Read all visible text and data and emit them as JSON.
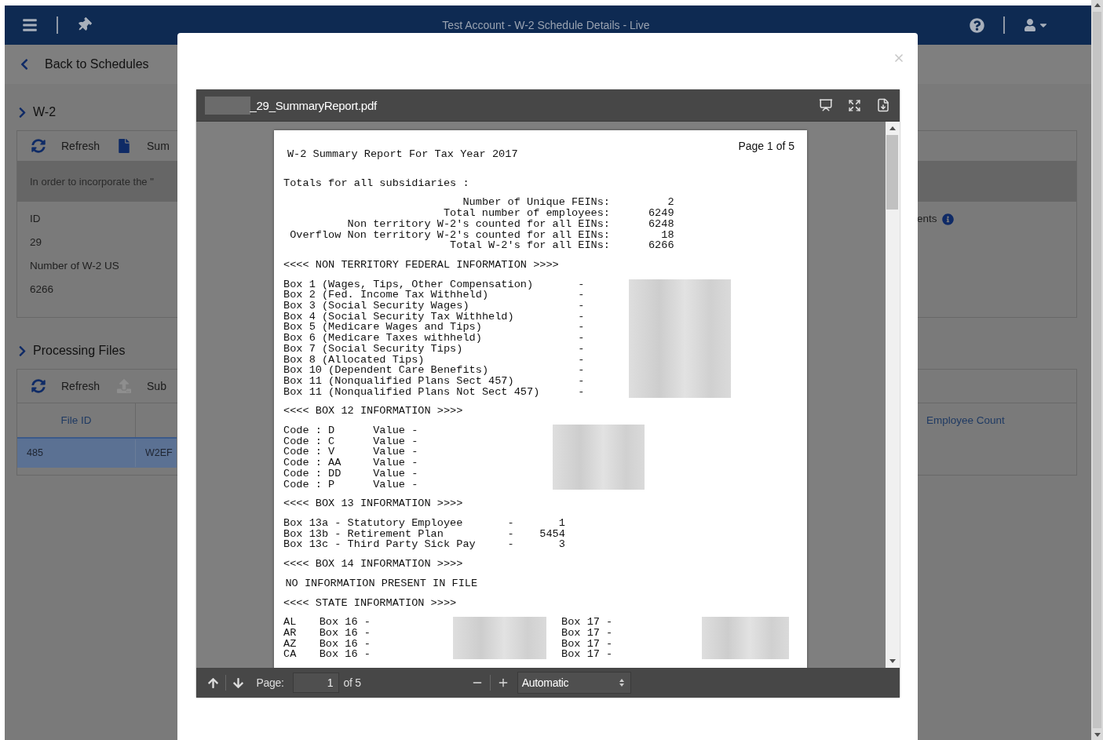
{
  "app_bar": {
    "title": "Test Account - W-2 Schedule Details - Live"
  },
  "back_link": {
    "label": "Back to Schedules"
  },
  "w2_section": {
    "title": "W-2",
    "toolbar": [
      {
        "kind": "refresh",
        "label": "Refresh",
        "disabled": false
      },
      {
        "kind": "file",
        "label": "Sum",
        "disabled": false
      }
    ],
    "notice": "In order to incorporate the \"",
    "fields": [
      {
        "label": "ID",
        "value": "29"
      },
      {
        "label": "Number of W-2 US",
        "value": "6266"
      }
    ],
    "right_field": {
      "label": "ents"
    }
  },
  "processing_section": {
    "title": "Processing Files",
    "toolbar": [
      {
        "kind": "refresh",
        "label": "Refresh",
        "disabled": false
      },
      {
        "kind": "upload",
        "label": "Sub",
        "disabled": true
      }
    ],
    "table": {
      "left_columns": [
        "File ID"
      ],
      "right_columns": [
        "Employee Count"
      ],
      "rows": [
        {
          "cells": [
            "485",
            "W2EF"
          ],
          "selected": true
        }
      ]
    }
  },
  "viewer": {
    "file_name": "_29_SummaryReport.pdf",
    "page_label": "Page:",
    "page_value": "1",
    "page_count": "of 5",
    "zoom": "Automatic",
    "report": {
      "page_number": "Page 1 of 5",
      "title": "W-2 Summary Report For Tax Year 2017",
      "sections": [
        {
          "kind": "totals",
          "heading": "Totals for all subsidiaries :",
          "rows": [
            {
              "label": "Number of Unique FEINs:",
              "value": "2"
            },
            {
              "label": "Total number of employees:",
              "value": "6249"
            },
            {
              "label": "Non territory W-2's counted for all EINs:",
              "value": "6248"
            },
            {
              "label": "Overflow Non territory W-2's counted for all EINs:",
              "value": "18"
            },
            {
              "label": "Total W-2's for all EINs:",
              "value": "6266"
            }
          ]
        },
        {
          "kind": "boxes",
          "heading": "<<<< NON TERRITORY FEDERAL INFORMATION >>>>",
          "rows": [
            {
              "label": "Box 1 (Wages, Tips, Other Compensation)",
              "mark": "-"
            },
            {
              "label": "Box 2 (Fed. Income Tax Withheld)",
              "mark": "-"
            },
            {
              "label": "Box 3 (Social Security Wages)",
              "mark": "-"
            },
            {
              "label": "Box 4 (Social Security Tax Withheld)",
              "mark": "-"
            },
            {
              "label": "Box 5 (Medicare Wages and Tips)",
              "mark": "-"
            },
            {
              "label": "Box 6 (Medicare Taxes withheld)",
              "mark": "-"
            },
            {
              "label": "Box 7 (Social Security Tips)",
              "mark": "-"
            },
            {
              "label": "Box 8 (Allocated Tips)",
              "mark": "-"
            },
            {
              "label": "Box 10 (Dependent Care Benefits)",
              "mark": "-"
            },
            {
              "label": "Box 11 (Nonqualified Plans Sect 457)",
              "mark": "-"
            },
            {
              "label": "Box 11 (Nonqualified Plans Not Sect 457)",
              "mark": "-"
            }
          ]
        },
        {
          "kind": "codes",
          "heading": "<<<< BOX 12 INFORMATION >>>>",
          "rows": [
            {
              "label": "Code : D",
              "value": "Value -"
            },
            {
              "label": "Code : C",
              "value": "Value -"
            },
            {
              "label": "Code : V",
              "value": "Value -"
            },
            {
              "label": "Code : AA",
              "value": "Value -"
            },
            {
              "label": "Code : DD",
              "value": "Value -"
            },
            {
              "label": "Code : P",
              "value": "Value -"
            }
          ]
        },
        {
          "kind": "box13",
          "heading": "<<<< BOX 13 INFORMATION >>>>",
          "rows": [
            {
              "label": "Box 13a - Statutory Employee",
              "mark": "-",
              "value": "1"
            },
            {
              "label": "Box 13b - Retirement Plan",
              "mark": "-",
              "value": "5454"
            },
            {
              "label": "Box 13c - Third Party Sick Pay",
              "mark": "-",
              "value": "3"
            }
          ]
        },
        {
          "kind": "note",
          "heading": "<<<< BOX 14 INFORMATION >>>>",
          "rows": [
            {
              "label": "NO INFORMATION PRESENT IN FILE"
            }
          ]
        },
        {
          "kind": "states",
          "heading": "<<<< STATE INFORMATION >>>>",
          "rows": [
            {
              "label": "AL",
              "box16": "Box 16 -",
              "box17": "Box 17 -"
            },
            {
              "label": "AR",
              "box16": "Box 16 -",
              "box17": "Box 17 -"
            },
            {
              "label": "AZ",
              "box16": "Box 16 -",
              "box17": "Box 17 -"
            },
            {
              "label": "CA",
              "box16": "Box 16 -",
              "box17": "Box 17 -"
            }
          ]
        }
      ]
    }
  }
}
